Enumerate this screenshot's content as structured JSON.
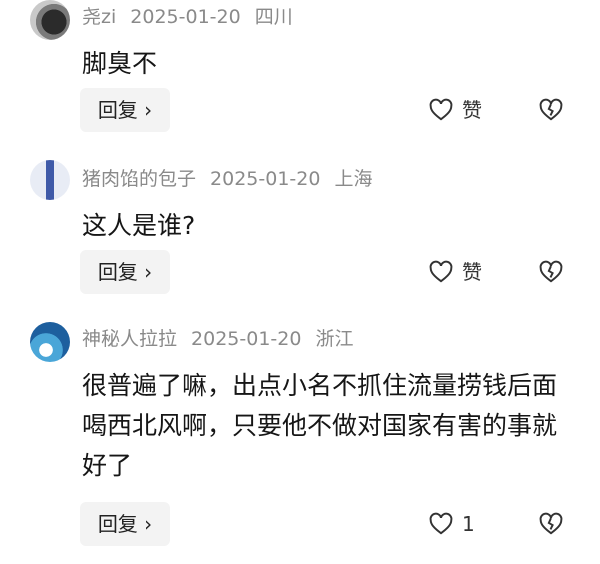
{
  "comments": [
    {
      "user": "尧zi",
      "date": "2025-01-20",
      "location": "四川",
      "text": "脚臭不",
      "reply_label": "回复 ›",
      "like_label": "赞"
    },
    {
      "user": "猪肉馅的包子",
      "date": "2025-01-20",
      "location": "上海",
      "text": "这人是谁?",
      "reply_label": "回复 ›",
      "like_label": "赞"
    },
    {
      "user": "神秘人拉拉",
      "date": "2025-01-20",
      "location": "浙江",
      "text": "很普遍了嘛，出点小名不抓住流量捞钱后面喝西北风啊，只要他不做对国家有害的事就好了",
      "reply_label": "回复 ›",
      "like_label": "1"
    }
  ],
  "icons": {
    "like": "heart-outline-icon",
    "dislike": "broken-heart-icon"
  }
}
